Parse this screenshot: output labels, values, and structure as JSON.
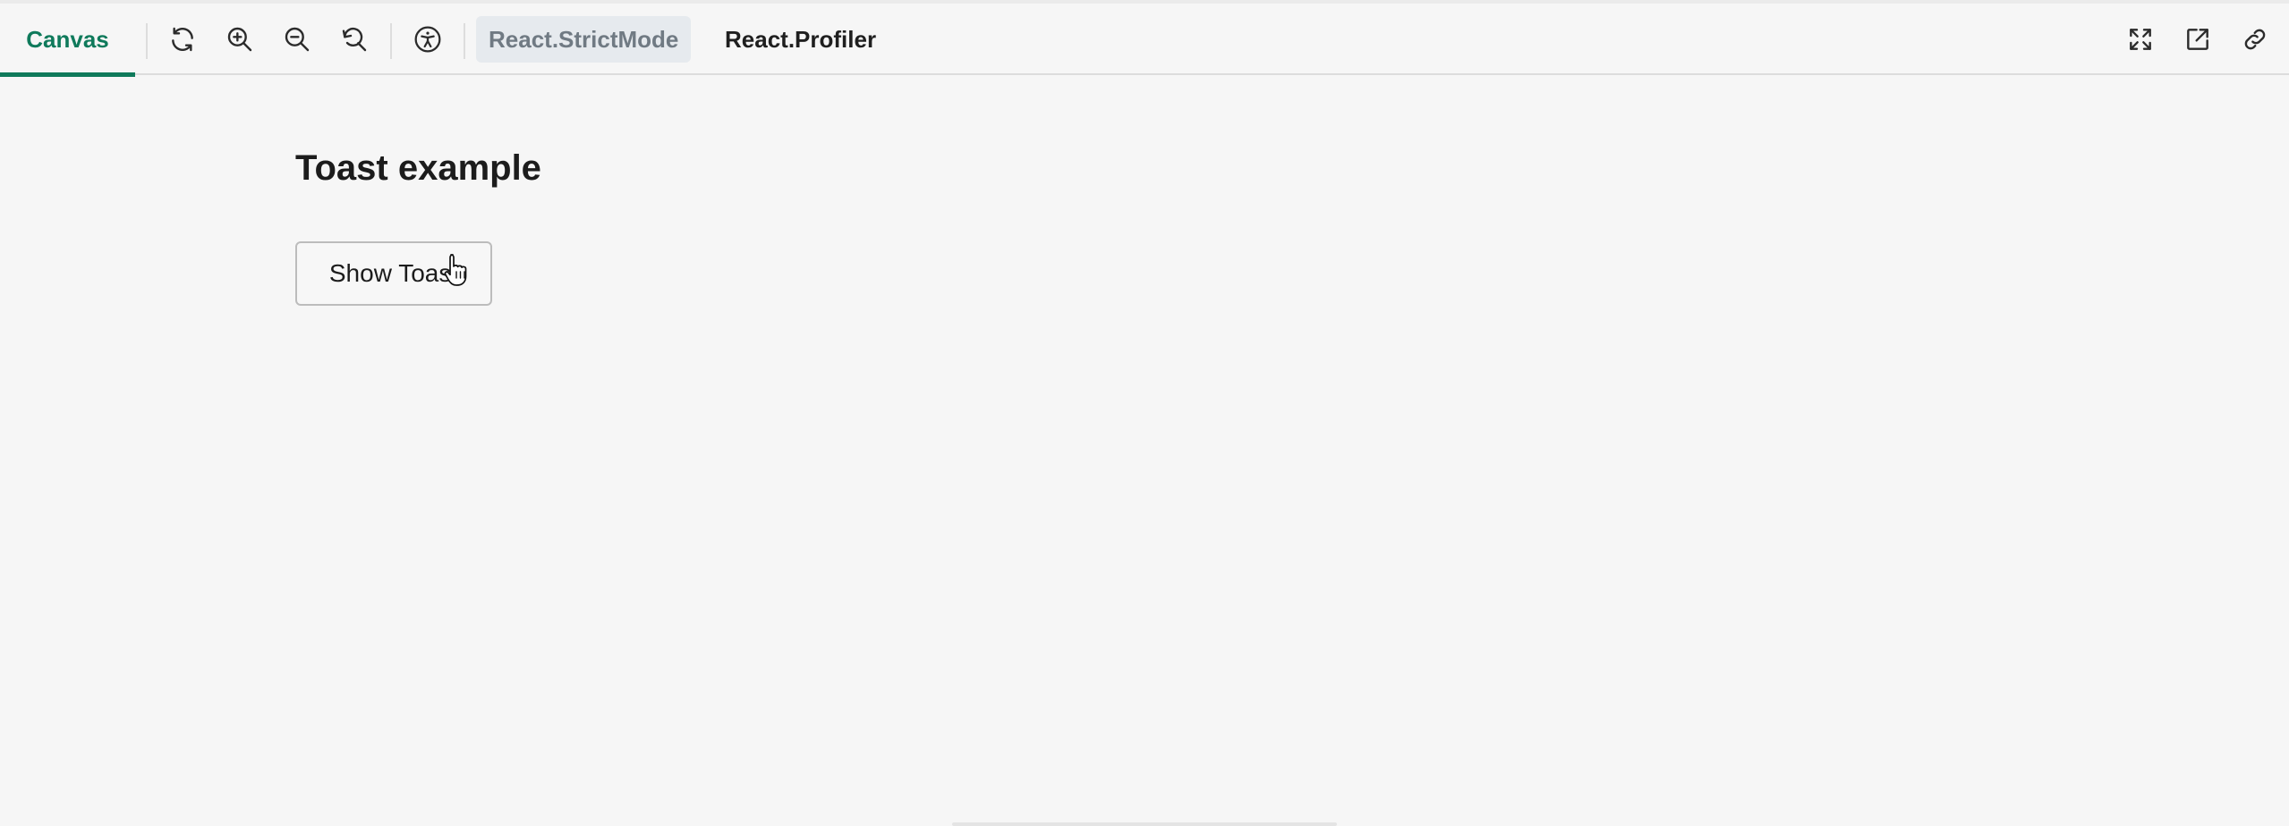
{
  "toolbar": {
    "canvas_tab_label": "Canvas",
    "strict_mode_label": "React.StrictMode",
    "profiler_label": "React.Profiler",
    "accent_color": "#0f7a5b",
    "left_icons": [
      "refresh-icon",
      "zoom-in-icon",
      "zoom-out-icon",
      "reset-zoom-icon",
      "accessibility-icon"
    ],
    "right_icons": [
      "fullscreen-icon",
      "open-new-tab-icon",
      "copy-link-icon"
    ]
  },
  "main": {
    "title": "Toast example",
    "show_toast_button_label": "Show Toast"
  }
}
